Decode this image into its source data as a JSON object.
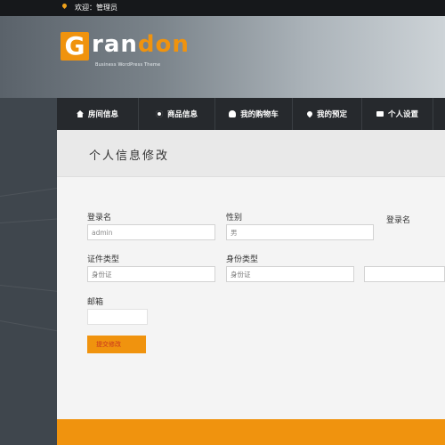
{
  "topbar": {
    "welcome": "欢迎：管理员"
  },
  "logo": {
    "letter": "G",
    "rest": "ran",
    "accent": "don",
    "tagline": "Business WordPress Theme"
  },
  "nav": {
    "items": [
      {
        "label": "房间信息",
        "icon": "home-icon"
      },
      {
        "label": "商品信息",
        "icon": "gear-icon"
      },
      {
        "label": "我的购物车",
        "icon": "user-icon"
      },
      {
        "label": "我的预定",
        "icon": "pin-icon"
      },
      {
        "label": "个人设置",
        "icon": "briefcase-icon"
      }
    ]
  },
  "panel": {
    "title": "个人信息修改"
  },
  "form": {
    "login_label": "登录名",
    "login_value": "admin",
    "gender_label": "性别",
    "gender_value": "男",
    "login2_label": "登录名",
    "cert_type_label": "证件类型",
    "cert_type_placeholder": "身份证",
    "id_type_label": "身份类型",
    "id_type_placeholder": "身份证",
    "email_label": "邮箱",
    "submit_label": "提交修改"
  },
  "colors": {
    "accent": "#f0930e",
    "nav_bg": "#26292d",
    "panel_bg": "#f4f4f4"
  }
}
